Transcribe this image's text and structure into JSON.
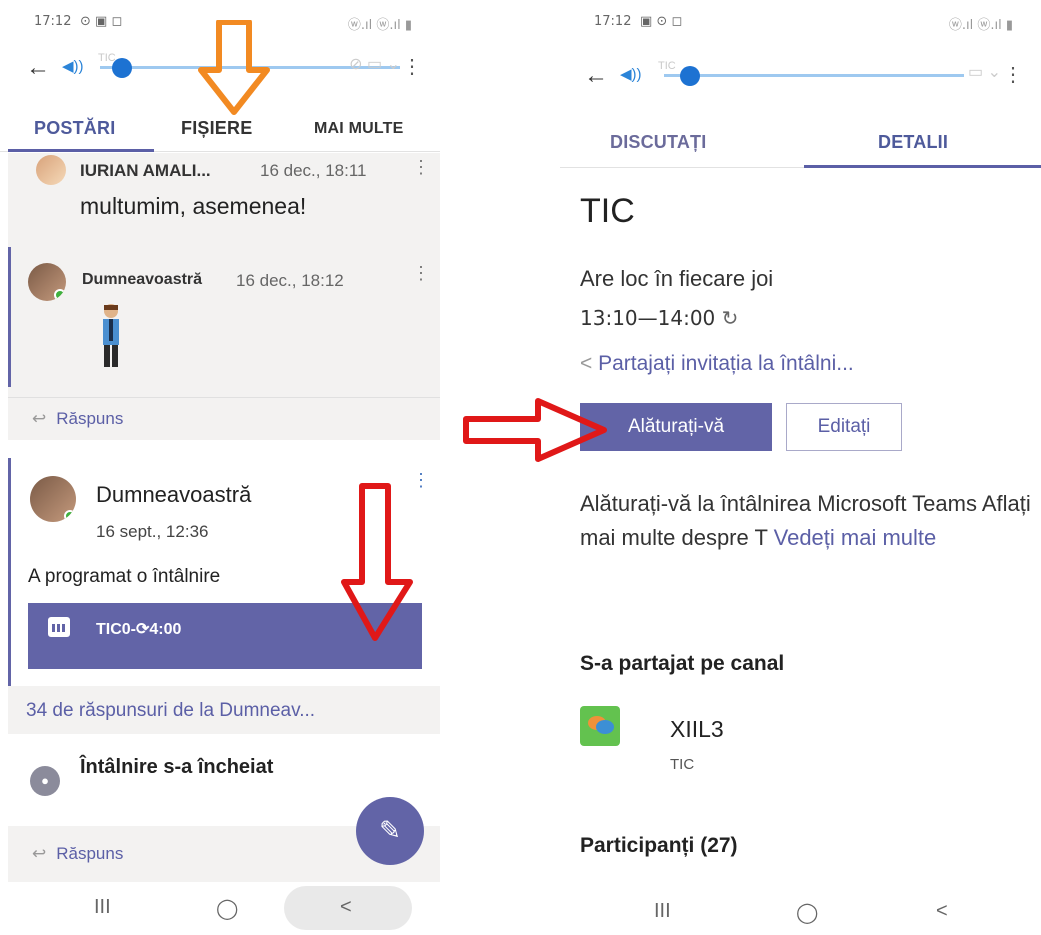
{
  "left": {
    "status": {
      "time": "17:12",
      "icons": "⊙ ▣ ◻",
      "signal": "ⓦ.ıl ⓦ.ıl ▮"
    },
    "call": {
      "label": "TIC"
    },
    "tabs": [
      "POSTĂRI",
      "FIȘIERE",
      "MAI MULTE"
    ],
    "thread1": {
      "author": "IURIAN AMALI...",
      "time": "16 dec., 18:11",
      "message": "multumim, asemenea!",
      "reply_author": "Dumneavoastră",
      "reply_time": "16 dec., 18:12",
      "reply_label": "Răspuns"
    },
    "thread2": {
      "author": "Dumneavoastră",
      "time": "16 sept., 12:36",
      "message": "A programat o întâlnire",
      "meeting": "TIC0-⟳4:00",
      "responses": "34 de răspunsuri de la Dumneav...",
      "ended": "Întâlnire s-a încheiat",
      "reply_label": "Răspuns"
    },
    "nav": {
      "recents": "III",
      "home": "◯",
      "back": "<"
    }
  },
  "right": {
    "status": {
      "time": "17:12",
      "icons": "▣ ⊙ ◻",
      "signal": "ⓦ.ıl ⓦ.ıl ▮"
    },
    "call": {
      "label": "TIC"
    },
    "tabs": [
      "DISCUTAȚI",
      "DETALII"
    ],
    "title": "TIC",
    "recurrence": "Are loc în fiecare joi",
    "time_range": "13:10—14:00",
    "share_link": "Partajați invitația la întâlni...",
    "join_button": "Alăturați-vă",
    "edit_button": "Editați",
    "description": "Alăturați-vă la întâlnirea Microsoft Teams Aflați mai multe despre T",
    "see_more": "Vedeți mai multe",
    "shared_heading": "S-a partajat pe canal",
    "channel": {
      "name": "XIIL3",
      "team": "TIC"
    },
    "participants": "Participanți (27)",
    "nav": {
      "recents": "III",
      "home": "◯",
      "back": "<"
    }
  },
  "colors": {
    "accent": "#6264a7",
    "link": "#5b5fa6",
    "annotation_red": "#e01818",
    "annotation_orange": "#f28a22",
    "presence": "#3fb13f"
  },
  "icons": [
    "back-arrow-icon",
    "speaker-icon",
    "more-vert-icon",
    "calendar-icon",
    "compose-icon",
    "share-icon",
    "recurrence-icon",
    "video-icon"
  ]
}
